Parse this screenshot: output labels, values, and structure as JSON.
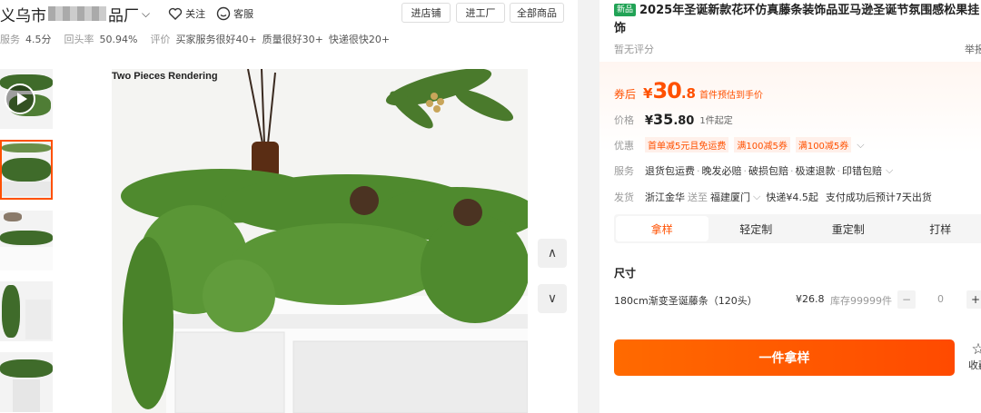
{
  "store": {
    "name_prefix": "义乌市",
    "name_suffix": "品厂",
    "follow_label": "关注",
    "service_label": "客服",
    "buttons": [
      "进店铺",
      "进工厂",
      "全部商品"
    ],
    "ratings": {
      "service_label": "服务",
      "service_value": "4.5分",
      "repurchase_label": "回头率",
      "repurchase_value": "50.94%",
      "eval_label": "评价",
      "tags": [
        "买家服务很好40+",
        "质量很好30+",
        "快递很快20+"
      ]
    }
  },
  "gallery": {
    "caption": "Two Pieces Rendering",
    "thumbnails": [
      "video",
      "garland-closeup",
      "garland-mantel",
      "garland-side",
      "garland-fireplace"
    ],
    "active_index": 1
  },
  "product": {
    "new_tag": "新品",
    "title": "2025年圣诞新款花环仿真藤条装饰品亚马逊圣诞节氛围感松果挂饰",
    "rating_text": "暂无评分",
    "report_label": "举报",
    "coupon_price_label": "券后",
    "coupon_yen": "¥",
    "coupon_price_int": "30",
    "coupon_price_dec": ".8",
    "coupon_note": "首件预估到手价",
    "price_label": "价格",
    "price_yen": "¥",
    "price_int": "35",
    "price_dec": ".80",
    "moq": "1件起定",
    "promo_label": "优惠",
    "promos": [
      "首单减5元且免运费",
      "满100减5券",
      "满100减5券"
    ],
    "service_label": "服务",
    "services": [
      "退货包运费",
      "晚发必赔",
      "破损包赔",
      "极速退款",
      "印错包赔"
    ],
    "ship_label": "发货",
    "ship_from": "浙江金华",
    "ship_to_label": "送至",
    "ship_to": "福建厦门",
    "shipping_fee": "快递¥4.5起",
    "delivery_eta": "支付成功后预计7天出货"
  },
  "tabs": [
    {
      "label": "拿样",
      "active": true
    },
    {
      "label": "轻定制",
      "active": false
    },
    {
      "label": "重定制",
      "active": false
    },
    {
      "label": "打样",
      "active": false
    }
  ],
  "sku": {
    "size_label": "尺寸",
    "name": "180cm渐变圣诞藤条（120头）",
    "price": "¥26.8",
    "stock": "库存99999件",
    "quantity": "0",
    "minus": "−",
    "plus": "+"
  },
  "actions": {
    "buy_label": "一件拿样",
    "fav_label": "收藏"
  },
  "colors": {
    "accent": "#ff5000",
    "new_tag": "#22a356"
  }
}
